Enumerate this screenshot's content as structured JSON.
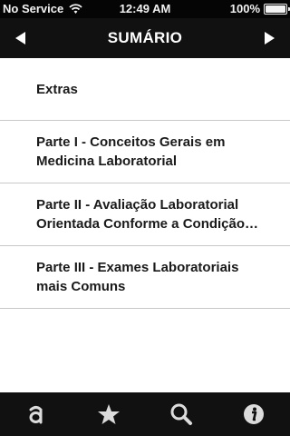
{
  "status_bar": {
    "carrier": "No Service",
    "time": "12:49 AM",
    "battery": "100%",
    "battery_level": 1.0
  },
  "nav": {
    "title": "SUMÁRIO",
    "back_icon": "left-arrow-icon",
    "forward_icon": "right-arrow-icon"
  },
  "list": {
    "items": [
      {
        "label": "Extras"
      },
      {
        "label": "Parte I - Conceitos Gerais em\nMedicina Laboratorial"
      },
      {
        "label": "Parte II - Avaliação Laboratorial\nOrientada Conforme a Condição Clínica"
      },
      {
        "label": "Parte III - Exames Laboratoriais\nmais Comuns"
      }
    ]
  },
  "tab_bar": {
    "tabs": [
      {
        "icon": "alphabetical-index-icon"
      },
      {
        "icon": "star-icon"
      },
      {
        "icon": "search-icon"
      },
      {
        "icon": "info-icon"
      }
    ]
  },
  "colors": {
    "bar_background": "#111111",
    "icon": "#dcdcdc",
    "separator": "#c8c8c8"
  }
}
